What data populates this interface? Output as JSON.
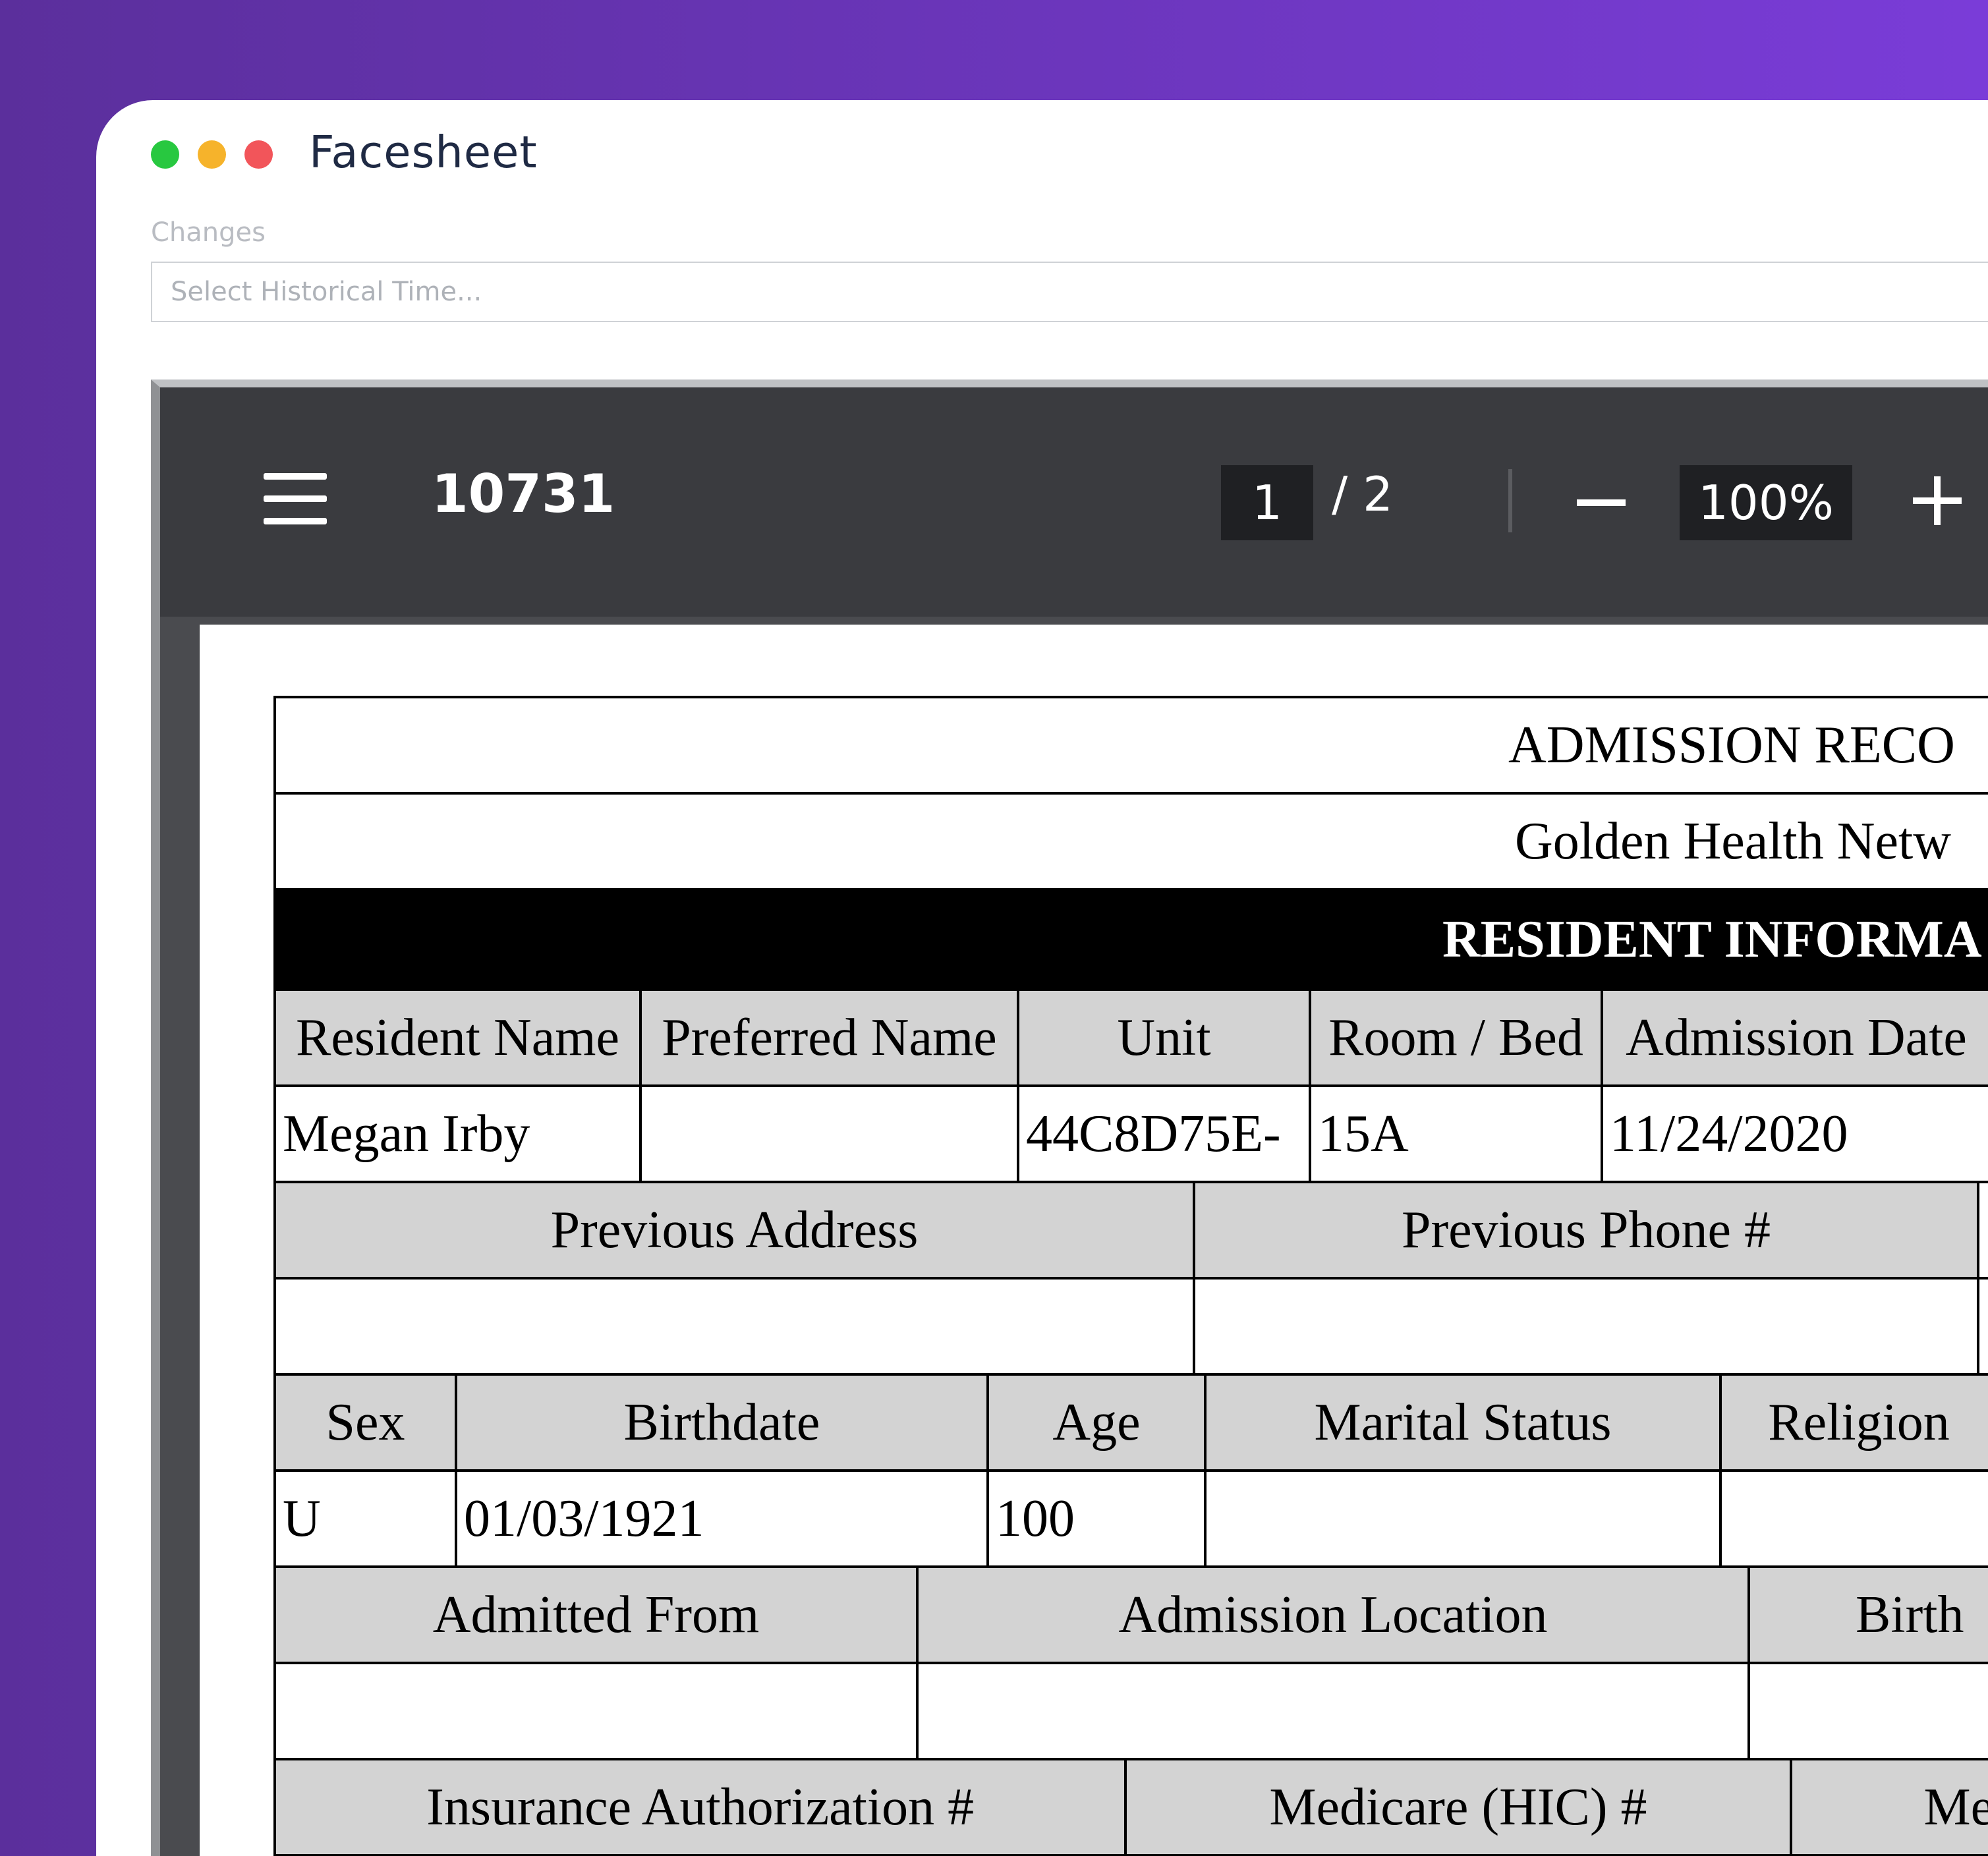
{
  "window": {
    "title": "Facesheet"
  },
  "changes": {
    "label": "Changes",
    "placeholder": "Select Historical Time..."
  },
  "toolbar": {
    "document_id": "10731",
    "current_page": "1",
    "page_total": "/ 2",
    "zoom": "100%"
  },
  "form": {
    "title": "ADMISSION RECO",
    "facility": "Golden Health Netw",
    "section": "RESIDENT INFORMA",
    "row1_headers": [
      "Resident Name",
      "Preferred Name",
      "Unit",
      "Room / Bed",
      "Admission Date"
    ],
    "row1_values": [
      "Megan Irby",
      "",
      "44C8D75E-",
      "15A",
      "11/24/2020"
    ],
    "row2_headers": [
      "Previous Address",
      "Previous Phone #"
    ],
    "row2_values": [
      "",
      ""
    ],
    "row3_headers": [
      "Sex",
      "Birthdate",
      "Age",
      "Marital Status",
      "Religion"
    ],
    "row3_values": [
      "U",
      "01/03/1921",
      "100",
      "",
      ""
    ],
    "row4_headers": [
      "Admitted From",
      "Admission Location",
      "Birth"
    ],
    "row4_values": [
      "",
      "",
      ""
    ],
    "row5_headers": [
      "Insurance Authorization #",
      "Medicare (HIC) #",
      "Me"
    ]
  },
  "colors": {
    "accent_start": "#5b2f9c",
    "accent_end": "#7a3cd8",
    "toolbar": "#3a3b3f"
  },
  "icons": [
    "menu-icon",
    "minus-icon",
    "plus-icon"
  ]
}
